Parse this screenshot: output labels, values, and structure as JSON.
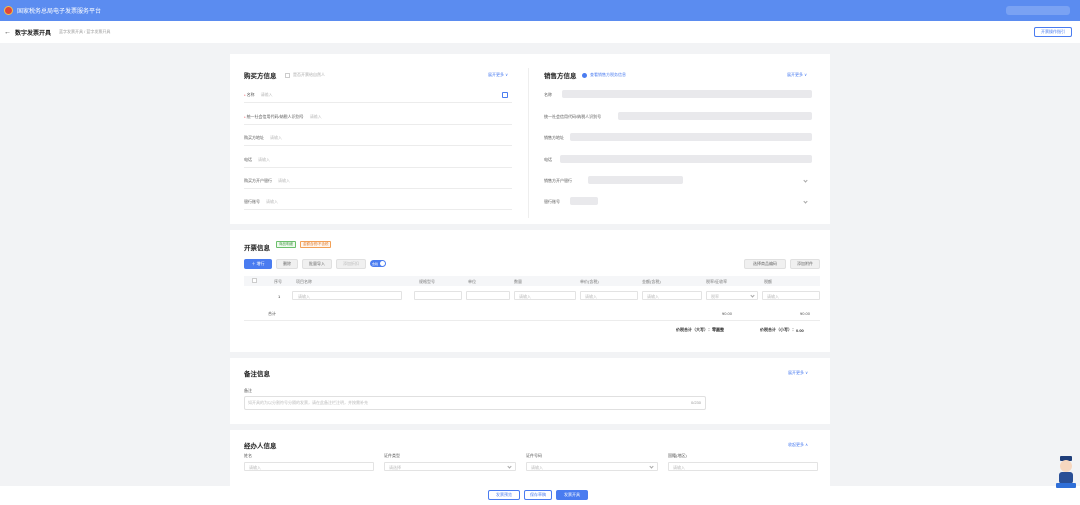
{
  "app": {
    "title": "国家税务总局电子发票服务平台"
  },
  "header": {
    "back": "←",
    "page_title": "数字发票开具",
    "breadcrumb": "蓝字发票开具 / 蓝字发票开具",
    "help_button": "开票操作指引"
  },
  "buyer": {
    "title": "购买方信息",
    "natural_person": "是否开票给自然人",
    "expand": "展开更多 ∨",
    "fields": [
      {
        "label": "名称",
        "required": true,
        "placeholder": "请输入"
      },
      {
        "label": "统一社会信用代码/纳税人识别号",
        "required": true,
        "placeholder": "请输入"
      },
      {
        "label": "购买方地址",
        "required": false,
        "placeholder": "请输入"
      },
      {
        "label": "电话",
        "required": false,
        "placeholder": "请输入"
      },
      {
        "label": "购买方开户银行",
        "required": false,
        "placeholder": "请输入"
      },
      {
        "label": "银行账号",
        "required": false,
        "placeholder": "请输入"
      }
    ]
  },
  "seller": {
    "title": "销售方信息",
    "subtitle": "查看销售方税务信息",
    "expand": "展开更多 ∨",
    "fields": [
      {
        "label": "名称"
      },
      {
        "label": "统一社会信用代码/纳税人识别号"
      },
      {
        "label": "销售方地址"
      },
      {
        "label": "电话"
      },
      {
        "label": "销售方开户银行"
      },
      {
        "label": "银行账号"
      }
    ]
  },
  "invoice": {
    "title": "开票信息",
    "tag_green": "商品明细",
    "tag_orange": "金额含税/不含税",
    "actions": {
      "add_row": "＋ 增行",
      "delete": "删除",
      "batch_import": "批量导入",
      "discount": "添加折扣",
      "toggle": "含税"
    },
    "right_actions": {
      "select_goods": "选择商品编码",
      "attach": "添加附件"
    },
    "columns": [
      "序号",
      "项目名称",
      "规格型号",
      "单位",
      "数量",
      "单价(含税)",
      "金额(含税)",
      "税率/征收率",
      "税额"
    ],
    "row": {
      "index": "1",
      "name_ph": "请输入",
      "qty_ph": "请输入",
      "price_ph": "请输入",
      "amount_ph": "请输入",
      "rate": "税率",
      "tax_ph": "请输入"
    },
    "subtotal_label": "合计",
    "subtotal_amount": "¥0.00",
    "subtotal_tax": "¥0.00",
    "total_upper_label": "价税合计（大写）：",
    "total_upper": "零圆整",
    "total_lower_label": "价税合计（小写）：",
    "total_lower": "0.00"
  },
  "remarks": {
    "title": "备注信息",
    "expand": "展开更多 ∨",
    "label": "备注",
    "placeholder": "如开具的为以分割符号分隔的发票，请在此备注栏注明，并按需补充",
    "counter": "0/230"
  },
  "handler": {
    "title": "经办人信息",
    "expand": "收起更多 ∧",
    "fields": [
      {
        "label": "姓名",
        "placeholder": "请输入"
      },
      {
        "label": "证件类型",
        "placeholder": "请选择"
      },
      {
        "label": "证件号码",
        "placeholder": "请输入"
      },
      {
        "label": "国籍(地区)",
        "placeholder": "请输入"
      }
    ]
  },
  "footer": {
    "preview": "发票预览",
    "save_draft": "保存草稿",
    "issue": "发票开具"
  },
  "colors": {
    "primary": "#4a7cf0",
    "topbar": "#5b8cf0"
  }
}
